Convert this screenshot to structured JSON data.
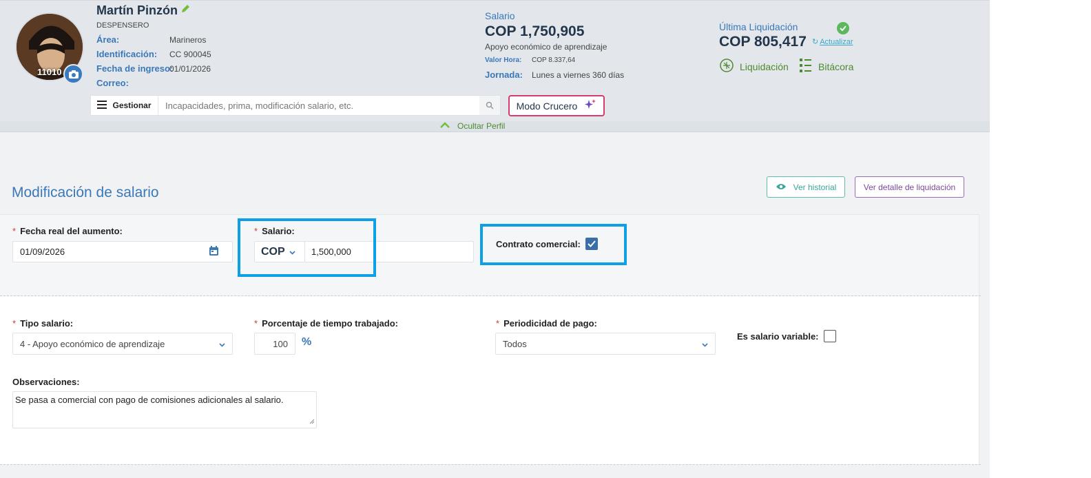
{
  "profile": {
    "name": "Martín Pinzón",
    "role": "DESPENSERO",
    "employee_number": "11010",
    "fields": [
      {
        "label": "Área:",
        "value": "Marineros"
      },
      {
        "label": "Identificación:",
        "value": "CC 900045"
      },
      {
        "label": "Fecha de ingreso:",
        "value": "01/01/2026"
      },
      {
        "label": "Correo:",
        "value": ""
      }
    ]
  },
  "salary": {
    "label": "Salario",
    "amount": "COP 1,750,905",
    "type": "Apoyo económico de aprendizaje",
    "hour_label": "Valor Hora:",
    "hour_value": "COP 8.337,64",
    "schedule_label": "Jornada:",
    "schedule_value": "Lunes a viernes 360 días"
  },
  "last_settlement": {
    "label": "Última Liquidación",
    "amount": "COP 805,417",
    "update_label": "Actualizar",
    "settlement_link": "Liquidación",
    "log_link": "Bitácora"
  },
  "toolbar": {
    "manage_label": "Gestionar",
    "search_placeholder": "Incapacidades, prima, modificación salario, etc.",
    "cruise_label": "Modo Crucero",
    "hide_profile_label": "Ocultar Perfil"
  },
  "section": {
    "title": "Modificación de salario",
    "history_button": "Ver historial",
    "detail_button": "Ver detalle de liquidación"
  },
  "form": {
    "date_label": "Fecha real del aumento:",
    "date_value": "01/09/2026",
    "salary_label": "Salario:",
    "currency": "COP",
    "salary_value": "1,500,000",
    "commercial_label": "Contrato comercial:",
    "commercial_checked": true,
    "salary_type_label": "Tipo salario:",
    "salary_type_value": "4 - Apoyo económico de aprendizaje",
    "percent_label": "Porcentaje de tiempo trabajado:",
    "percent_value": "100",
    "percent_symbol": "%",
    "period_label": "Periodicidad de pago:",
    "period_value": "Todos",
    "variable_label": "Es salario variable:",
    "variable_checked": false,
    "notes_label": "Observaciones:",
    "notes_value": "Se pasa a comercial con pago de comisiones adicionales al salario."
  },
  "colors": {
    "accent_blue": "#3a78b8",
    "highlight": "#0ea0e6",
    "green": "#4c8a2e",
    "required": "#d9363e"
  }
}
